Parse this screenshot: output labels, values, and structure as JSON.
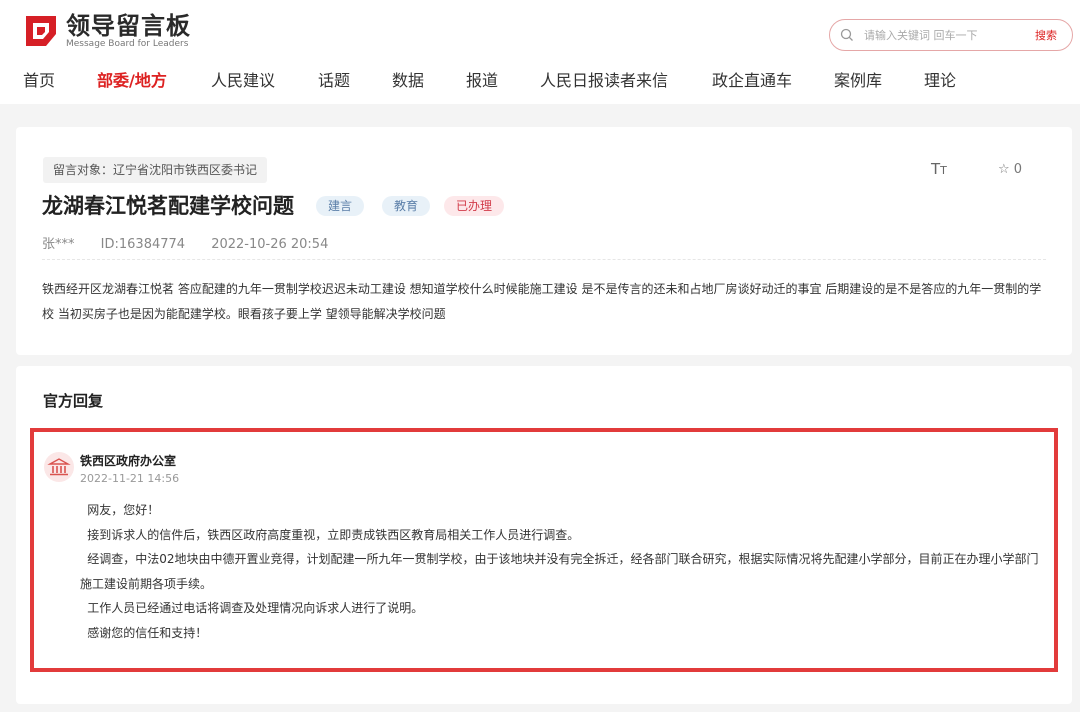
{
  "header": {
    "logo_cn": "领导留言板",
    "logo_en": "Message Board for Leaders",
    "search": {
      "placeholder": "请输入关键词 回车一下",
      "button": "搜索"
    },
    "nav": [
      {
        "label": "首页",
        "active": false
      },
      {
        "label": "部委/地方",
        "active": true
      },
      {
        "label": "人民建议",
        "active": false
      },
      {
        "label": "话题",
        "active": false
      },
      {
        "label": "数据",
        "active": false
      },
      {
        "label": "报道",
        "active": false
      },
      {
        "label": "人民日报读者来信",
        "active": false
      },
      {
        "label": "政企直通车",
        "active": false
      },
      {
        "label": "案例库",
        "active": false
      },
      {
        "label": "理论",
        "active": false
      }
    ]
  },
  "message": {
    "target": "留言对象：辽宁省沈阳市铁西区委书记",
    "font_tool": "TT",
    "star_count": "0",
    "title": "龙湖春江悦茗配建学校问题",
    "tags": [
      "建言",
      "教育",
      "已办理"
    ],
    "author": "张***",
    "id": "ID:16384774",
    "datetime": "2022-10-26 20:54",
    "content": "铁西经开区龙湖春江悦茗 答应配建的九年一贯制学校迟迟未动工建设 想知道学校什么时候能施工建设 是不是传言的还未和占地厂房谈好动迁的事宜 后期建设的是不是答应的九年一贯制的学校 当初买房子也是因为能配建学校。眼看孩子要上学 望领导能解决学校问题"
  },
  "reply": {
    "heading": "官方回复",
    "org": "铁西区政府办公室",
    "date": "2022-11-21 14:56",
    "paragraphs": [
      "网友，您好！",
      "接到诉求人的信件后，铁西区政府高度重视，立即责成铁西区教育局相关工作人员进行调查。",
      "经调查，中法02地块由中德开置业竞得，计划配建一所九年一贯制学校，由于该地块并没有完全拆迁，经各部门联合研究，根据实际情况将先配建小学部分，目前正在办理小学部门施工建设前期各项手续。",
      "工作人员已经通过电话将调查及处理情况向诉求人进行了说明。",
      "感谢您的信任和支持！"
    ]
  },
  "colors": {
    "accent": "#d22222",
    "highlight_border": "#e23b3b"
  }
}
